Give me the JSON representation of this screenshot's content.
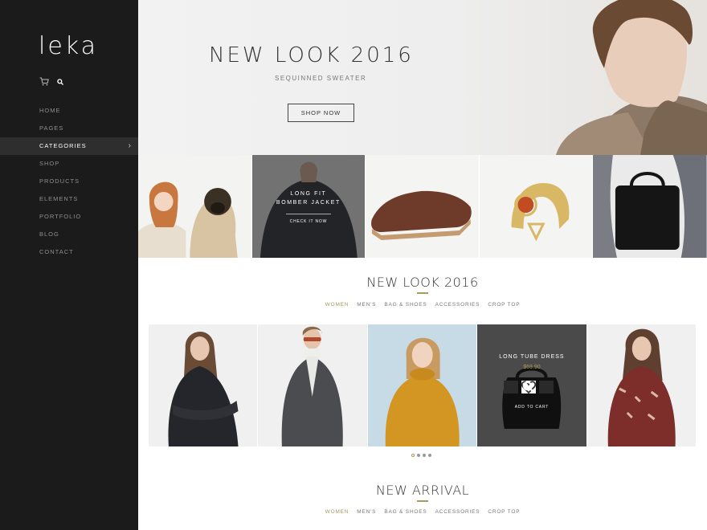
{
  "brand": {
    "logo": "leka"
  },
  "sidebar": {
    "icons": [
      "cart-icon",
      "search-icon"
    ],
    "items": [
      {
        "label": "HOME"
      },
      {
        "label": "PAGES"
      },
      {
        "label": "CATEGORIES",
        "chevron": "›"
      },
      {
        "label": "SHOP"
      },
      {
        "label": "PRODUCTS"
      },
      {
        "label": "ELEMENTS"
      },
      {
        "label": "PORTFOLIO"
      },
      {
        "label": "BLOG"
      },
      {
        "label": "CONTACT"
      }
    ]
  },
  "hero": {
    "title": "NEW LOOK 2016",
    "subtitle": "SEQUINNED SWEATER",
    "button": "SHOP NOW"
  },
  "categories": {
    "overlay_title_line1": "LONG FIT",
    "overlay_title_line2": "BOMBER JACKET",
    "overlay_cta": "CHECK IT NOW"
  },
  "section1": {
    "title": "NEW LOOK 2016",
    "tabs": [
      "WOMEN",
      "MEN'S",
      "BAG & SHOES",
      "ACCESSORIES",
      "CROP TOP"
    ],
    "active_tab": "WOMEN"
  },
  "product_hover": {
    "name": "LONG TUBE DRESS",
    "price": "$69.90",
    "add_to_cart": "ADD TO CART",
    "actions": [
      "shuffle-icon",
      "heart-icon",
      "search-icon"
    ]
  },
  "carousel": {
    "dots": 4,
    "active": 0
  },
  "section2": {
    "title": "NEW ARRIVAL",
    "tabs": [
      "WOMEN",
      "MEN'S",
      "BAG & SHOES",
      "ACCESSORIES",
      "CROP TOP"
    ],
    "active_tab": "WOMEN"
  },
  "colors": {
    "sidebar": "#1b1b1b",
    "accent": "#a89a5a",
    "hover_bg": "#4a4a4a"
  }
}
